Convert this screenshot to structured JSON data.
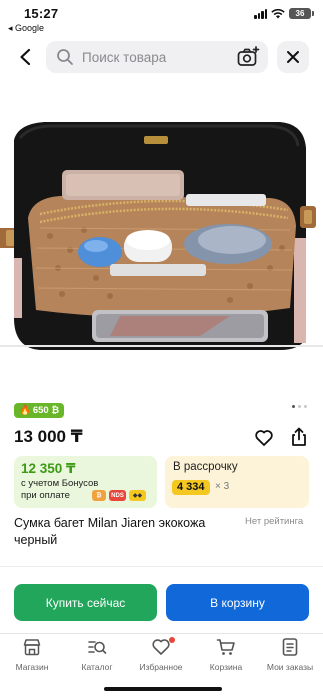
{
  "status_bar": {
    "time": "15:27",
    "back_app": "◂ Google",
    "battery": "36",
    "icons": [
      "signal-icon",
      "wifi-icon",
      "battery-icon"
    ]
  },
  "search": {
    "placeholder": "Поиск товара",
    "icons": [
      "back-arrow-icon",
      "search-icon",
      "camera-icon",
      "close-icon"
    ]
  },
  "product_image": {
    "description_icon": "bag-photo",
    "pager": {
      "count": 3,
      "active": 1
    }
  },
  "product": {
    "bonus_badge": "650 ₿",
    "price": "13 000 ₸",
    "bonus_price": "12 350 ₸",
    "bonus_caption_line1": "с учетом Бонусов",
    "bonus_caption_line2": "при оплате",
    "bonus_chips": [
      "kaspi",
      "NDS",
      "gold"
    ],
    "installment_title": "В рассрочку",
    "installment_amount": "4 334",
    "installment_multiplier": "× 3",
    "title": "Сумка багет Milan Jiaren экокожа черный",
    "rating": "Нет рейтинга"
  },
  "actions": {
    "buy_now": "Купить сейчас",
    "add_to_cart": "В корзину"
  },
  "tab_bar": {
    "items": [
      {
        "label": "Магазин",
        "icon": "shop-icon"
      },
      {
        "label": "Каталог",
        "icon": "catalog-icon"
      },
      {
        "label": "Избранное",
        "icon": "heart-icon"
      },
      {
        "label": "Корзина",
        "icon": "cart-icon"
      },
      {
        "label": "Мои заказы",
        "icon": "orders-icon"
      }
    ]
  },
  "colors": {
    "buy_button": "#21a65b",
    "cart_button": "#1168d9",
    "bonus_green": "#3d9a14",
    "installment_yellow": "#f5c821",
    "badge_green": "#6ab62a",
    "notification_dot": "#e8463b"
  }
}
